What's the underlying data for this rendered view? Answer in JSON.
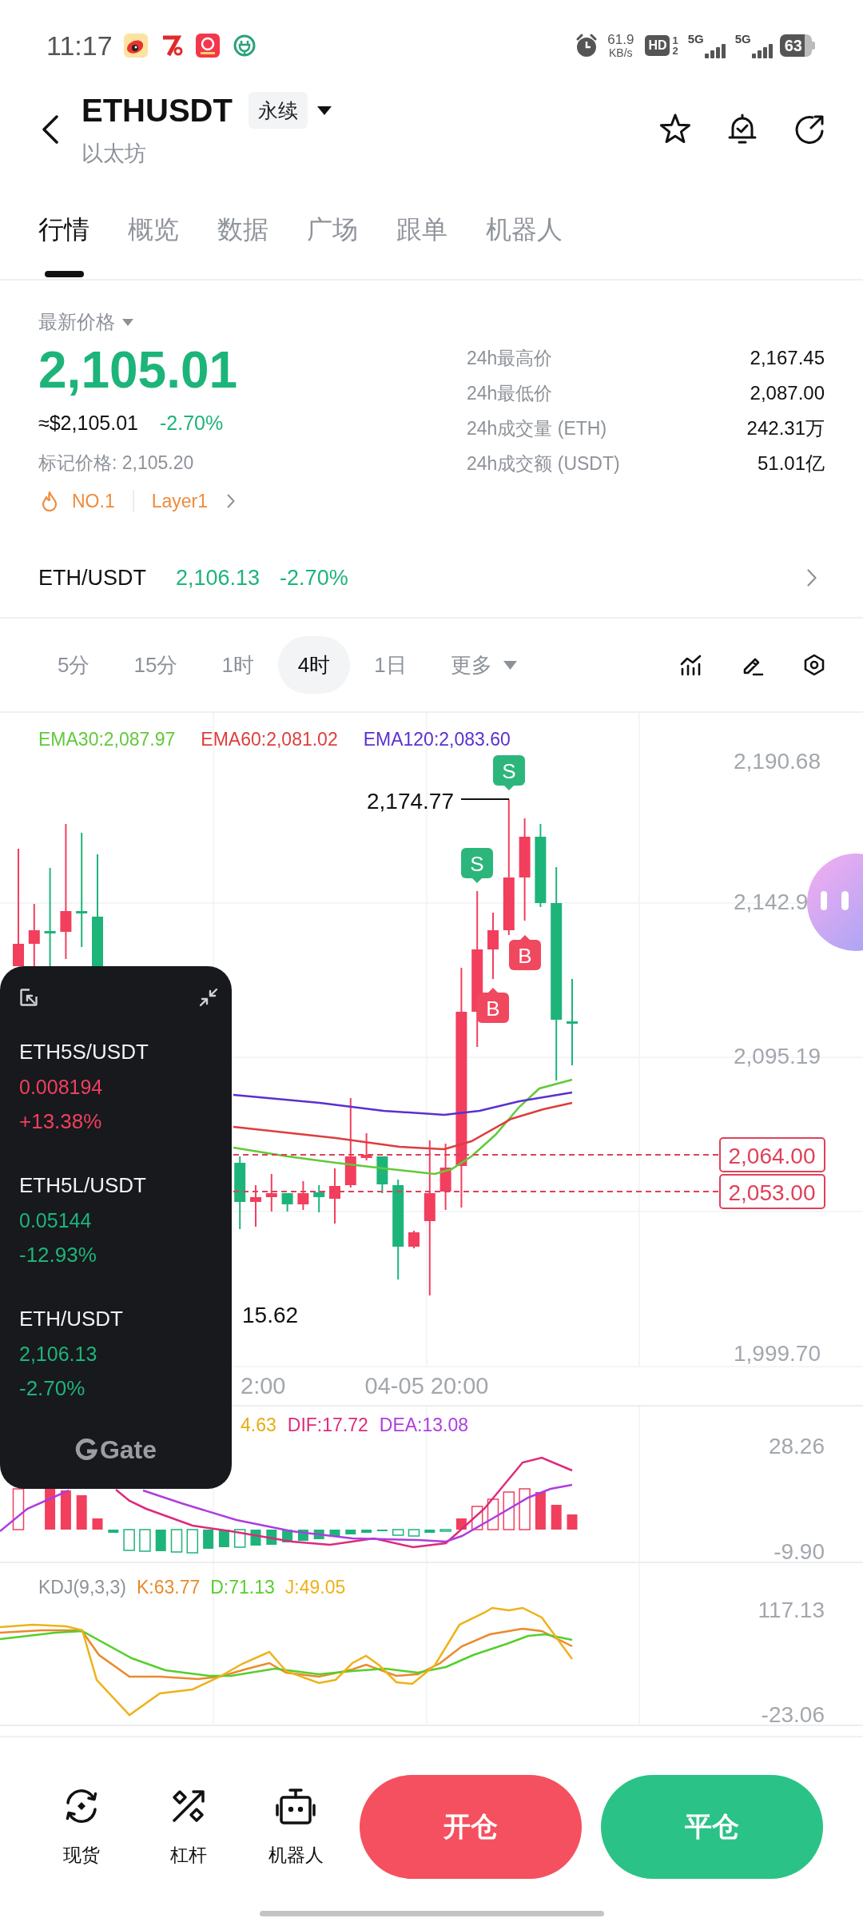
{
  "status_bar": {
    "time": "11:17",
    "speed": "61.9",
    "speed_unit": "KB/s",
    "hd": "HD",
    "sim_slots": [
      "1",
      "2"
    ],
    "networks": [
      "5G",
      "5G"
    ],
    "battery": "63"
  },
  "header": {
    "symbol": "ETHUSDT",
    "contract_type": "永续",
    "asset_name": "以太坊"
  },
  "tabs": [
    {
      "label": "行情",
      "selected": true
    },
    {
      "label": "概览",
      "selected": false
    },
    {
      "label": "数据",
      "selected": false
    },
    {
      "label": "广场",
      "selected": false
    },
    {
      "label": "跟单",
      "selected": false
    },
    {
      "label": "机器人",
      "selected": false
    }
  ],
  "price_panel": {
    "label": "最新价格",
    "last_price": "2,105.01",
    "rising": false,
    "usd_price": "≈$2,105.01",
    "change": "-2.70%",
    "mark_price": "标记价格: 2,105.20",
    "tags": [
      {
        "kind": "rank",
        "label": "NO.1"
      },
      {
        "kind": "sector",
        "label": "Layer1"
      }
    ],
    "stats": [
      {
        "label": "24h最高价",
        "value": "2,167.45"
      },
      {
        "label": "24h最低价",
        "value": "2,087.00"
      },
      {
        "label": "24h成交量 (ETH)",
        "value": "242.31万"
      },
      {
        "label": "24h成交额 (USDT)",
        "value": "51.01亿"
      }
    ]
  },
  "spot_row": {
    "pair": "ETH/USDT",
    "price": "2,106.13",
    "change": "-2.70%",
    "rising": false
  },
  "intervals": [
    {
      "label": "5分",
      "selected": false
    },
    {
      "label": "15分",
      "selected": false
    },
    {
      "label": "1时",
      "selected": false
    },
    {
      "label": "4时",
      "selected": true
    },
    {
      "label": "1日",
      "selected": false
    }
  ],
  "more_intervals": "更多",
  "chart": {
    "legend": [
      {
        "label": "EMA30:2,087.97",
        "color": "#62c93a"
      },
      {
        "label": "EMA60:2,081.02",
        "color": "#de3d3d"
      },
      {
        "label": "EMA120:2,083.60",
        "color": "#5a30d0"
      }
    ],
    "y_axis": [
      "2,190.68",
      "2,142.9",
      "2,095.19",
      "1,999.70"
    ],
    "x_axis": [
      "2:00",
      "04-05 20:00"
    ],
    "high_label": "2,174.77",
    "low_label": "15.62",
    "markers": [
      {
        "kind": "sell",
        "label": "S"
      },
      {
        "kind": "sell",
        "label": "S"
      },
      {
        "kind": "buy",
        "label": "B"
      },
      {
        "kind": "buy",
        "label": "B"
      }
    ],
    "price_lines": [
      "2,064.00",
      "2,053.00"
    ]
  },
  "macd": {
    "legend": [
      {
        "label": "4.63",
        "color": "#e6ad12"
      },
      {
        "label": "DIF:17.72",
        "color": "#dd2a7c"
      },
      {
        "label": "DEA:13.08",
        "color": "#ad3ddf"
      }
    ],
    "y_axis": [
      "28.26",
      "-9.90"
    ]
  },
  "kdj": {
    "title": "KDJ(9,3,3)",
    "legend": [
      {
        "label": "K:63.77",
        "color": "#ea8a2c"
      },
      {
        "label": "D:71.13",
        "color": "#55cf2c"
      },
      {
        "label": "J:49.05",
        "color": "#eeb21a"
      }
    ],
    "y_axis": [
      "117.13",
      "-23.06"
    ]
  },
  "floating_window": {
    "items": [
      {
        "pair": "ETH5S/USDT",
        "price": "0.008194",
        "change": "+13.38%",
        "rising": true
      },
      {
        "pair": "ETH5L/USDT",
        "price": "0.05144",
        "change": "-12.93%",
        "rising": false
      },
      {
        "pair": "ETH/USDT",
        "price": "2,106.13",
        "change": "-2.70%",
        "rising": false
      }
    ],
    "brand": "Gate"
  },
  "bottom_bar": {
    "shortcuts": [
      {
        "kind": "spot",
        "label": "现货"
      },
      {
        "kind": "leverage",
        "label": "杠杆"
      },
      {
        "kind": "bot",
        "label": "机器人"
      }
    ],
    "actions": [
      {
        "kind": "open",
        "label": "开仓"
      },
      {
        "kind": "close",
        "label": "平仓"
      }
    ]
  }
}
